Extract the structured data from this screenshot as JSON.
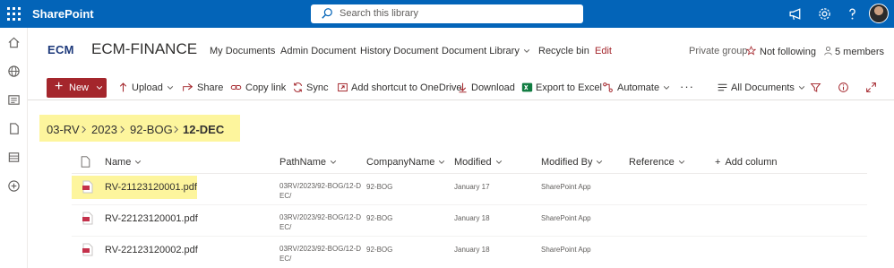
{
  "suite": {
    "app_name": "SharePoint",
    "search_placeholder": "Search this library"
  },
  "site": {
    "logo_text": "ECM",
    "title": "ECM-FINANCE",
    "nav": [
      "My Documents",
      "Admin Document",
      "History Document",
      "Document Library",
      "Recycle bin",
      "Edit"
    ],
    "group_type": "Private group",
    "follow_label": "Not following",
    "members_label": "5 members"
  },
  "commands": {
    "new_label": "New",
    "upload": "Upload",
    "share": "Share",
    "copy_link": "Copy link",
    "sync": "Sync",
    "add_shortcut": "Add shortcut to OneDrive",
    "download": "Download",
    "export_excel": "Export to Excel",
    "automate": "Automate",
    "more": "···",
    "view": "All Documents"
  },
  "breadcrumb": [
    "03-RV",
    "2023",
    "92-BOG",
    "12-DEC"
  ],
  "columns": {
    "name": "Name",
    "pathname": "PathName",
    "company": "CompanyName",
    "modified": "Modified",
    "modified_by": "Modified By",
    "reference": "Reference",
    "add_column": "Add column"
  },
  "rows": [
    {
      "name": "RV-21123120001.pdf",
      "path": "03RV/2023/92-BOG/12-DEC/",
      "company": "92-BOG",
      "modified": "January 17",
      "modified_by": "SharePoint App"
    },
    {
      "name": "RV-22123120001.pdf",
      "path": "03RV/2023/92-BOG/12-DEC/",
      "company": "92-BOG",
      "modified": "January 18",
      "modified_by": "SharePoint App"
    },
    {
      "name": "RV-22123120002.pdf",
      "path": "03RV/2023/92-BOG/12-DEC/",
      "company": "92-BOG",
      "modified": "January 18",
      "modified_by": "SharePoint App"
    }
  ],
  "colors": {
    "suite_bar": "#0364b8",
    "brand_red": "#a4262c",
    "highlight": "#fdf59d"
  }
}
